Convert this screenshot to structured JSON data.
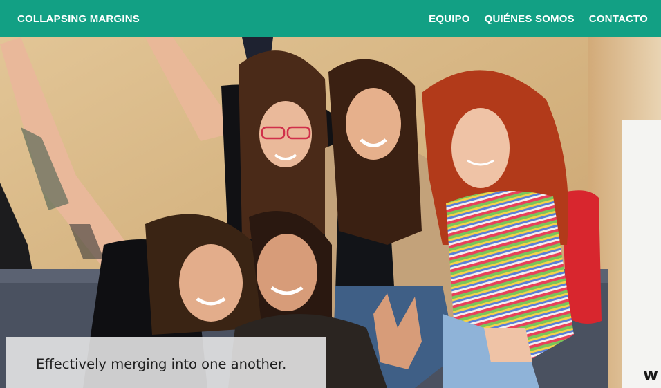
{
  "header": {
    "brand": "COLLAPSING MARGINS",
    "nav": [
      {
        "label": "EQUIPO"
      },
      {
        "label": "QUIÉNES SOMOS"
      },
      {
        "label": "CONTACTO"
      }
    ]
  },
  "hero": {
    "caption": "Effectively merging into one another."
  },
  "colors": {
    "header_bg": "#12a084",
    "header_text": "#ffffff",
    "caption_bg": "#e8e8e8",
    "wall": "#d8b98a"
  }
}
